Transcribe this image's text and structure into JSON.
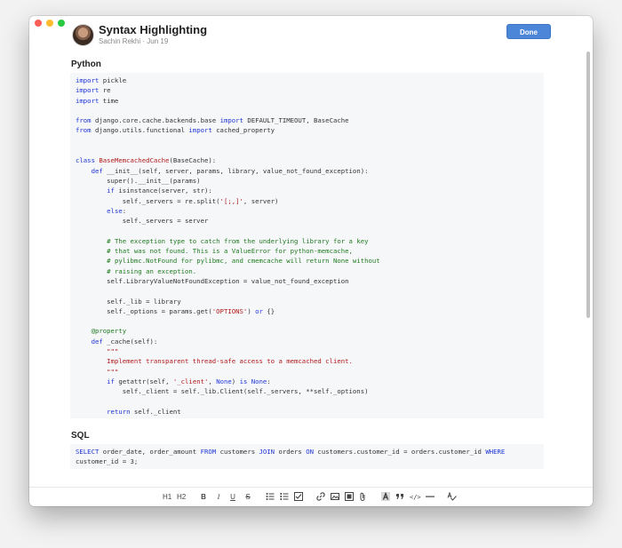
{
  "window": {
    "title": "Syntax Highlighting",
    "author": "Sachin Rekhi",
    "date": "Jun 19",
    "meta_sep": " · "
  },
  "header": {
    "done_label": "Done"
  },
  "sections": {
    "python_heading": "Python",
    "sql_heading": "SQL"
  },
  "python_code": [
    [
      [
        "kw",
        "import"
      ],
      [
        "p",
        " pickle"
      ]
    ],
    [
      [
        "kw",
        "import"
      ],
      [
        "p",
        " re"
      ]
    ],
    [
      [
        "kw",
        "import"
      ],
      [
        "p",
        " time"
      ]
    ],
    [],
    [
      [
        "kw",
        "from"
      ],
      [
        "p",
        " django.core.cache.backends.base "
      ],
      [
        "kw",
        "import"
      ],
      [
        "p",
        " DEFAULT_TIMEOUT, BaseCache"
      ]
    ],
    [
      [
        "kw",
        "from"
      ],
      [
        "p",
        " django.utils.functional "
      ],
      [
        "kw",
        "import"
      ],
      [
        "p",
        " cached_property"
      ]
    ],
    [],
    [],
    [
      [
        "kw",
        "class"
      ],
      [
        "p",
        " "
      ],
      [
        "cls",
        "BaseMemcachedCache"
      ],
      [
        "p",
        "(BaseCache):"
      ]
    ],
    [
      [
        "p",
        "    "
      ],
      [
        "kw",
        "def"
      ],
      [
        "p",
        " __init__(self, server, params, library, value_not_found_exception):"
      ]
    ],
    [
      [
        "p",
        "        super().__init__(params)"
      ]
    ],
    [
      [
        "p",
        "        "
      ],
      [
        "kw",
        "if"
      ],
      [
        "p",
        " isinstance(server, str):"
      ]
    ],
    [
      [
        "p",
        "            self._servers = re.split("
      ],
      [
        "str",
        "'[;,]'"
      ],
      [
        "p",
        ", server)"
      ]
    ],
    [
      [
        "p",
        "        "
      ],
      [
        "kw",
        "else"
      ],
      [
        "p",
        ":"
      ]
    ],
    [
      [
        "p",
        "            self._servers = server"
      ]
    ],
    [],
    [
      [
        "p",
        "        "
      ],
      [
        "com",
        "# The exception type to catch from the underlying library for a key"
      ]
    ],
    [
      [
        "p",
        "        "
      ],
      [
        "com",
        "# that was not found. This is a ValueError for python-memcache,"
      ]
    ],
    [
      [
        "p",
        "        "
      ],
      [
        "com",
        "# pylibmc.NotFound for pylibmc, and cmemcache will return None without"
      ]
    ],
    [
      [
        "p",
        "        "
      ],
      [
        "com",
        "# raising an exception."
      ]
    ],
    [
      [
        "p",
        "        self.LibraryValueNotFoundException = value_not_found_exception"
      ]
    ],
    [],
    [
      [
        "p",
        "        self._lib = library"
      ]
    ],
    [
      [
        "p",
        "        self._options = params.get("
      ],
      [
        "str",
        "'OPTIONS'"
      ],
      [
        "p",
        ") "
      ],
      [
        "kw",
        "or"
      ],
      [
        "p",
        " {}"
      ]
    ],
    [],
    [
      [
        "p",
        "    "
      ],
      [
        "dec",
        "@property"
      ]
    ],
    [
      [
        "p",
        "    "
      ],
      [
        "kw",
        "def"
      ],
      [
        "p",
        " _cache(self):"
      ]
    ],
    [
      [
        "p",
        "        "
      ],
      [
        "str",
        "\"\"\""
      ]
    ],
    [
      [
        "p",
        "        "
      ],
      [
        "str",
        "Implement transparent thread-safe access to a memcached client."
      ]
    ],
    [
      [
        "p",
        "        "
      ],
      [
        "str",
        "\"\"\""
      ]
    ],
    [
      [
        "p",
        "        "
      ],
      [
        "kw",
        "if"
      ],
      [
        "p",
        " getattr(self, "
      ],
      [
        "str",
        "'_client'"
      ],
      [
        "p",
        ", "
      ],
      [
        "kw",
        "None"
      ],
      [
        "p",
        ") "
      ],
      [
        "kw",
        "is None"
      ],
      [
        "p",
        ":"
      ]
    ],
    [
      [
        "p",
        "            self._client = self._lib.Client(self._servers, **self._options)"
      ]
    ],
    [],
    [
      [
        "p",
        "        "
      ],
      [
        "kw",
        "return"
      ],
      [
        "p",
        " self._client"
      ]
    ]
  ],
  "sql_code": [
    [
      [
        "kw",
        "SELECT"
      ],
      [
        "p",
        " order_date, order_amount "
      ],
      [
        "kw",
        "FROM"
      ],
      [
        "p",
        " customers "
      ],
      [
        "kw",
        "JOIN"
      ],
      [
        "p",
        " orders "
      ],
      [
        "kw",
        "ON"
      ],
      [
        "p",
        " customers.customer_id = orders.customer_id "
      ],
      [
        "kw",
        "WHERE"
      ]
    ],
    [
      [
        "p",
        "customer_id = 3;"
      ]
    ]
  ],
  "colors": {
    "keyword": "#1e36d6",
    "string": "#b11a1a",
    "comment": "#1f7a1f",
    "button": "#4b86d8"
  },
  "toolbar": {
    "heading1": "H1",
    "heading2": "H2",
    "bold": "B",
    "italic": "I",
    "underline": "U",
    "strike": "S",
    "code_inline": "</>",
    "icons": [
      "bullet-list-icon",
      "numbered-list-icon",
      "checklist-icon",
      "link-icon",
      "image-icon",
      "video-icon",
      "attachment-icon",
      "text-style-icon",
      "quote-icon",
      "code-icon",
      "divider-icon",
      "spellcheck-icon"
    ]
  }
}
